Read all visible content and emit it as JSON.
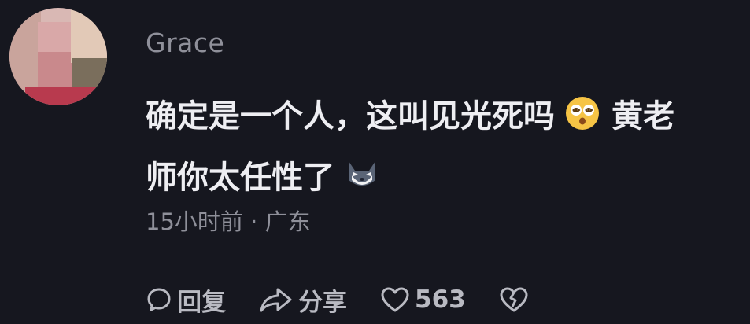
{
  "comment": {
    "username": "Grace",
    "text_line1": "确定是一个人，这叫见光死吗",
    "text_line1_tail": "黄老",
    "text_line2": "师你太任性了",
    "time": "15小时前",
    "separator": " · ",
    "location": "广东",
    "emojis": [
      "dizzy-face-emoji",
      "wolf-emoji"
    ]
  },
  "actions": {
    "reply_label": "回复",
    "share_label": "分享",
    "like_count": "563"
  },
  "colors": {
    "background": "#16171f",
    "username": "#8f909a",
    "text": "#eeeef2",
    "meta": "#8f909a",
    "actions": "#b9bac2"
  }
}
